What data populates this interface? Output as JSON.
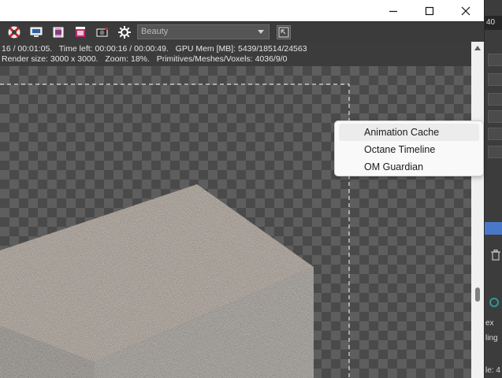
{
  "window": {
    "controls": {
      "minimize_icon": "minimize-icon",
      "maximize_icon": "maximize-icon",
      "close_icon": "close-icon"
    }
  },
  "toolbar": {
    "icons": [
      "lifebuoy-icon",
      "monitor-icon",
      "film-reel-icon",
      "render-box-icon",
      "camera-icon",
      "settings-icon"
    ],
    "pass_select": {
      "value": "Beauty"
    },
    "expand_icon": "expand-icon"
  },
  "status": {
    "line1": "16 / 00:01:05.   Time left: 00:00:16 / 00:00:49.   GPU Mem [MB]: 5439/18514/24563",
    "line2": "Render size: 3000 x 3000.   Zoom: 18%.   Primitives/Meshes/Voxels: 4036/9/0"
  },
  "context_menu": {
    "items": [
      {
        "label": "Animation Cache"
      },
      {
        "label": "Octane Timeline"
      },
      {
        "label": "OM Guardian"
      }
    ]
  },
  "right_panel": {
    "number": "40",
    "label_ex": "ex",
    "label_ling": "ling",
    "label_le": "le: 4",
    "trash_icon": "trash-icon"
  },
  "colors": {
    "menu_bg": "#f9f9f9",
    "menu_hover": "#ececec",
    "panel_accent": "#4a78c8",
    "ui_dark": "#3c3c3c"
  }
}
